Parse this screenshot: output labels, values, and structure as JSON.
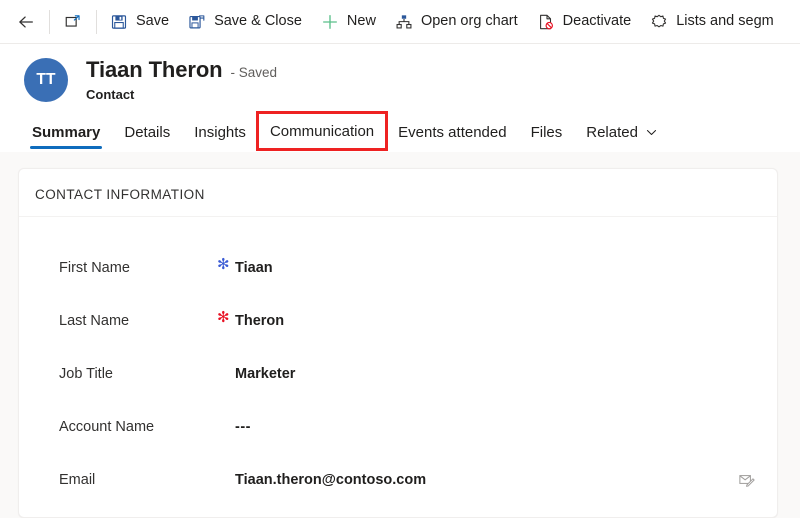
{
  "commandbar": {
    "items": [
      {
        "key": "back",
        "label": "",
        "icon": "back-arrow-icon",
        "icon_only": true
      },
      {
        "key": "popout",
        "label": "",
        "icon": "open-in-new-window-icon",
        "icon_only": true
      },
      {
        "key": "save",
        "label": "Save",
        "icon": "save-icon",
        "icon_only": false
      },
      {
        "key": "save_close",
        "label": "Save & Close",
        "icon": "save-and-close-icon",
        "icon_only": false
      },
      {
        "key": "new",
        "label": "New",
        "icon": "plus-icon",
        "icon_only": false
      },
      {
        "key": "org_chart",
        "label": "Open org chart",
        "icon": "org-chart-icon",
        "icon_only": false
      },
      {
        "key": "deactivate",
        "label": "Deactivate",
        "icon": "deactivate-icon",
        "icon_only": false
      },
      {
        "key": "lists",
        "label": "Lists and segm",
        "icon": "lists-segments-icon",
        "icon_only": false
      }
    ]
  },
  "record": {
    "avatar_initials": "TT",
    "name": "Tiaan Theron",
    "status": "- Saved",
    "entity": "Contact"
  },
  "tabs": [
    {
      "key": "summary",
      "label": "Summary",
      "active": true,
      "annotated": false,
      "chevron": false
    },
    {
      "key": "details",
      "label": "Details",
      "active": false,
      "annotated": false,
      "chevron": false
    },
    {
      "key": "insights",
      "label": "Insights",
      "active": false,
      "annotated": false,
      "chevron": false
    },
    {
      "key": "communication",
      "label": "Communication",
      "active": false,
      "annotated": true,
      "chevron": false
    },
    {
      "key": "events",
      "label": "Events attended",
      "active": false,
      "annotated": false,
      "chevron": false
    },
    {
      "key": "files",
      "label": "Files",
      "active": false,
      "annotated": false,
      "chevron": false
    },
    {
      "key": "related",
      "label": "Related",
      "active": false,
      "annotated": false,
      "chevron": true
    }
  ],
  "form": {
    "section_title": "CONTACT INFORMATION",
    "fields": [
      {
        "key": "first_name",
        "label": "First Name",
        "value": "Tiaan",
        "requirement": "recommended",
        "action_icon": ""
      },
      {
        "key": "last_name",
        "label": "Last Name",
        "value": "Theron",
        "requirement": "required",
        "action_icon": ""
      },
      {
        "key": "job_title",
        "label": "Job Title",
        "value": "Marketer",
        "requirement": "none",
        "action_icon": ""
      },
      {
        "key": "account_name",
        "label": "Account Name",
        "value": "---",
        "requirement": "none",
        "action_icon": ""
      },
      {
        "key": "email",
        "label": "Email",
        "value": "Tiaan.theron@contoso.com",
        "requirement": "none",
        "action_icon": "compose-email-icon"
      }
    ]
  },
  "colors": {
    "accent_blue": "#0f6cbd",
    "avatar_blue": "#3a6fb5",
    "required_red": "#e81123",
    "recommended_blue": "#3b5bd4",
    "annotation_red": "#ee2222",
    "new_green": "#5bbf8a"
  }
}
